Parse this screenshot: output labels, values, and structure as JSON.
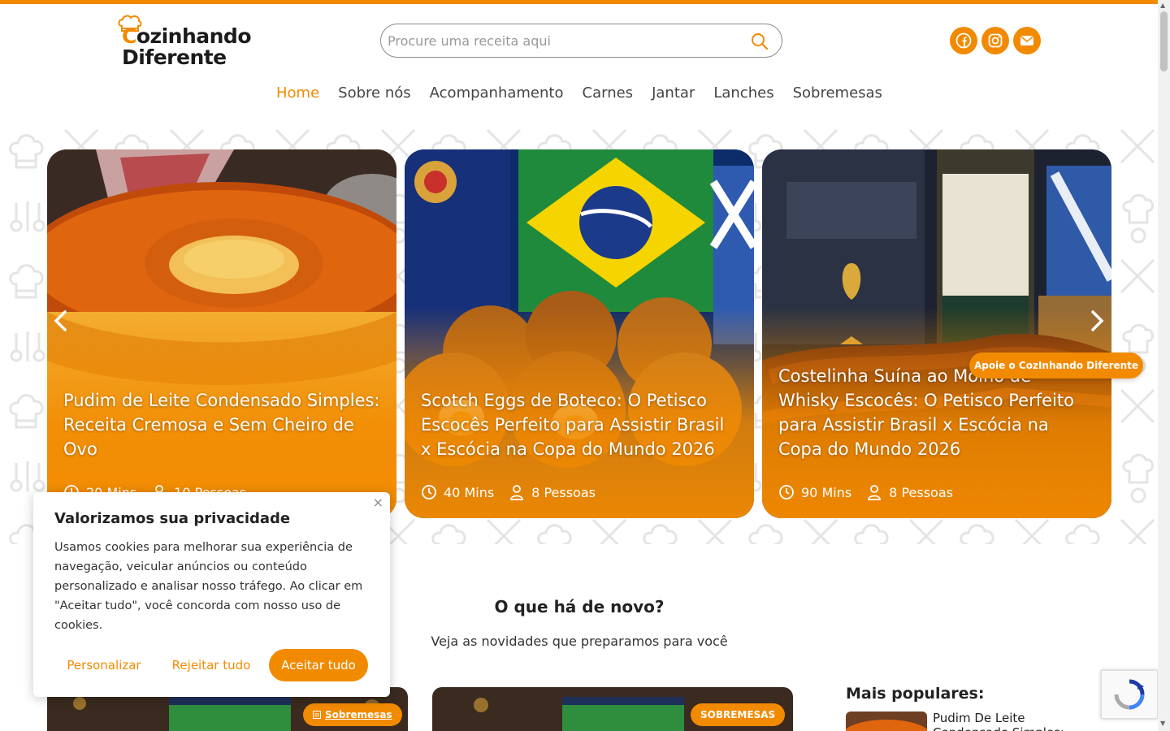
{
  "brand": {
    "name_line1": "Cozinhando",
    "name_line1_first": "C",
    "name_line1_rest": "ozinhando",
    "name_line2": "Diferente",
    "accent": "#f28a00"
  },
  "search": {
    "placeholder": "Procure uma receita aqui",
    "icon": "search-icon"
  },
  "social": [
    {
      "name": "facebook",
      "icon": "facebook-icon"
    },
    {
      "name": "instagram",
      "icon": "instagram-icon"
    },
    {
      "name": "email",
      "icon": "envelope-icon"
    }
  ],
  "nav": [
    {
      "label": "Home",
      "active": true
    },
    {
      "label": "Sobre nós",
      "active": false
    },
    {
      "label": "Acompanhamento",
      "active": false
    },
    {
      "label": "Carnes",
      "active": false
    },
    {
      "label": "Jantar",
      "active": false
    },
    {
      "label": "Lanches",
      "active": false
    },
    {
      "label": "Sobremesas",
      "active": false
    }
  ],
  "carousel": {
    "slides": [
      {
        "title": "Pudim de Leite Condensado Simples: Receita Cremosa e Sem Cheiro de Ovo",
        "time": "20 Mins",
        "servings": "10 Pessoas"
      },
      {
        "title": "Scotch Eggs de Boteco: O Petisco Escocês Perfeito para Assistir Brasil x Escócia na Copa do Mundo 2026",
        "time": "40 Mins",
        "servings": "8 Pessoas"
      },
      {
        "title": "Costelinha Suína ao Molho de Whisky Escocês: O Petisco Perfeito para Assistir Brasil x Escócia na Copa do Mundo 2026",
        "time": "90 Mins",
        "servings": "8 Pessoas"
      }
    ],
    "prev_icon": "chevron-left-icon",
    "next_icon": "chevron-right-icon"
  },
  "support_button": "Apoie o CozInhando Diferente",
  "news": {
    "title": "O que há de novo?",
    "subtitle": "Veja as novidades que preparamos para você",
    "posts": [
      {
        "badge": "Sobremesas"
      },
      {
        "badge": "SOBREMESAS"
      }
    ]
  },
  "popular": {
    "title": "Mais populares:",
    "items": [
      {
        "title": "Pudim De Leite Condensado Simples:"
      }
    ]
  },
  "cookie": {
    "title": "Valorizamos sua privacidade",
    "text": "Usamos cookies para melhorar sua experiência de navegação, veicular anúncios ou conteúdo personalizado e analisar nosso tráfego. Ao clicar em \"Aceitar tudo\", você concorda com nosso uso de cookies.",
    "customize": "Personalizar",
    "reject": "Rejeitar tudo",
    "accept": "Aceitar tudo",
    "close": "×"
  }
}
